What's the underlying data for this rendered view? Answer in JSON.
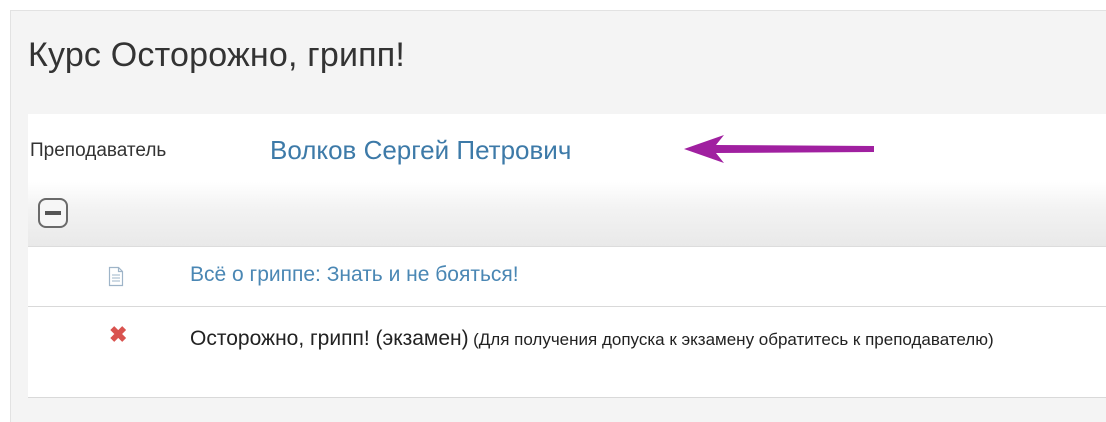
{
  "course": {
    "title": "Курс Осторожно, грипп!"
  },
  "teacher": {
    "label": "Преподаватель",
    "name": "Волков Сергей Петрович"
  },
  "annotation": {
    "arrow_color": "#a020a0"
  },
  "section": {
    "toggle_icon": "collapse-minus-icon"
  },
  "activities": [
    {
      "icon": "page-icon",
      "title": "Всё о гриппе: Знать и не бояться!"
    },
    {
      "icon": "close-icon",
      "icon_color": "#d9534f",
      "icon_glyph": "✖",
      "title": "Осторожно, грипп! (экзамен)",
      "note": "(Для получения допуска к экзамену обратитесь к преподавателю)"
    }
  ]
}
